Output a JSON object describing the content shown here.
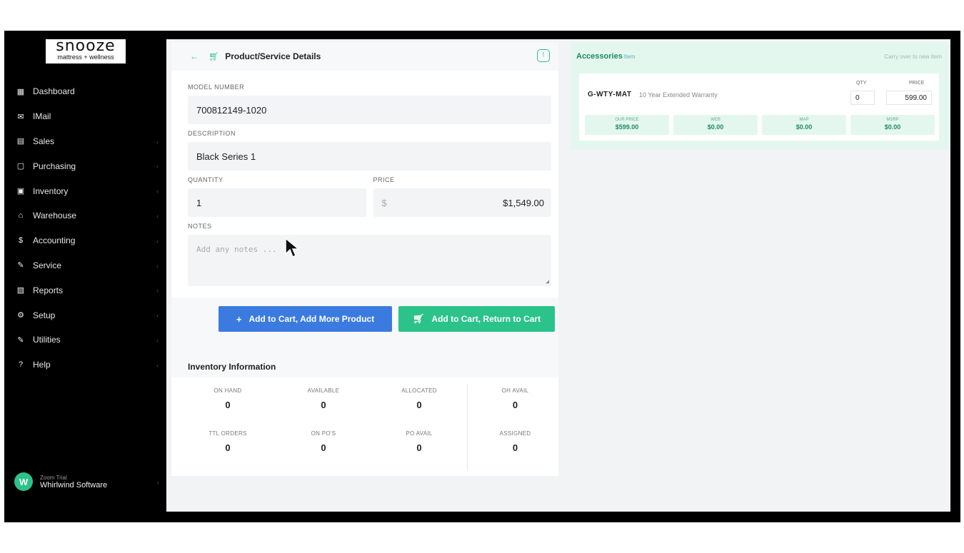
{
  "brand": {
    "name": "snooze",
    "tagline": "mattress + wellness"
  },
  "sidebar": {
    "items": [
      {
        "label": "Dashboard",
        "icon": "dashboard-icon"
      },
      {
        "label": "IMail",
        "icon": "mail-icon"
      },
      {
        "label": "Sales",
        "icon": "sales-icon"
      },
      {
        "label": "Purchasing",
        "icon": "purchasing-icon"
      },
      {
        "label": "Inventory",
        "icon": "inventory-icon"
      },
      {
        "label": "Warehouse",
        "icon": "warehouse-icon"
      },
      {
        "label": "Accounting",
        "icon": "dollar-icon"
      },
      {
        "label": "Service",
        "icon": "wrench-icon"
      },
      {
        "label": "Reports",
        "icon": "reports-icon"
      },
      {
        "label": "Setup",
        "icon": "gear-icon"
      },
      {
        "label": "Utilities",
        "icon": "wrench-icon"
      },
      {
        "label": "Help",
        "icon": "help-icon"
      }
    ],
    "user": {
      "initial": "W",
      "name": "Zoom Trial",
      "org": "Whirlwind Software"
    }
  },
  "details": {
    "title": "Product/Service Details",
    "model_label": "MODEL NUMBER",
    "model_value": "700812149-1020",
    "description_label": "DESCRIPTION",
    "description_value": "Black Series 1",
    "quantity_label": "QUANTITY",
    "quantity_value": "1",
    "price_label": "PRICE",
    "price_symbol": "$",
    "price_value": "$1,549.00",
    "notes_label": "NOTES",
    "notes_placeholder": "Add any notes ...",
    "add_more_label": "Add to Cart, Add More Product",
    "return_label": "Add to Cart, Return to Cart"
  },
  "inventory": {
    "title": "Inventory Information",
    "cells": [
      {
        "label": "ON HAND",
        "value": "0"
      },
      {
        "label": "AVAILABLE",
        "value": "0"
      },
      {
        "label": "ALLOCATED",
        "value": "0"
      },
      {
        "label": "OH AVAIL",
        "value": "0"
      },
      {
        "label": "TTL ORDERS",
        "value": "0"
      },
      {
        "label": "ON PO'S",
        "value": "0"
      },
      {
        "label": "PO AVAIL",
        "value": "0"
      },
      {
        "label": "ASSIGNED",
        "value": "0"
      }
    ]
  },
  "accessories": {
    "title": "Accessories",
    "count": "Item",
    "right_text": "Carry over to new item",
    "item": {
      "code": "G-WTY-MAT",
      "desc": "10 Year Extended Warranty",
      "qty_label": "QTY",
      "price_label": "PRICE",
      "qty": "0",
      "price": "599.00",
      "stats": [
        {
          "label": "OUR PRICE",
          "value": "$599.00"
        },
        {
          "label": "WEB",
          "value": "$0.00"
        },
        {
          "label": "MAP",
          "value": "$0.00"
        },
        {
          "label": "MSRP",
          "value": "$0.00"
        }
      ]
    }
  },
  "colors": {
    "accent": "#2bc38a",
    "primary_button": "#3b7be0",
    "sidebar": "#000000"
  }
}
